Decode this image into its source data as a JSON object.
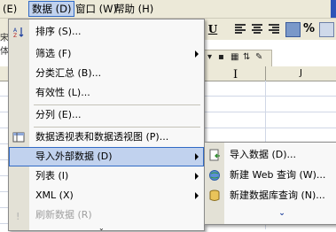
{
  "menubar": {
    "items": [
      {
        "label": "(E)"
      },
      {
        "label": "数据 (D)"
      },
      {
        "label": "窗口 (W)"
      },
      {
        "label": "帮助 (H)"
      }
    ]
  },
  "toolbar": {
    "underline": "U",
    "left_cut": "宋体"
  },
  "sheet": {
    "col_j": "J",
    "col_i_cursor": "I"
  },
  "data_menu": {
    "items": [
      {
        "label": "排序 (S)...",
        "submenu": false,
        "disabled": false
      },
      {
        "label": "筛选 (F)",
        "submenu": true,
        "disabled": false
      },
      {
        "label": "分类汇总 (B)...",
        "submenu": false,
        "disabled": false
      },
      {
        "label": "有效性 (L)...",
        "submenu": false,
        "disabled": false
      },
      {
        "label": "分列 (E)...",
        "submenu": false,
        "disabled": false
      },
      {
        "label": "数据透视表和数据透视图 (P)...",
        "submenu": false,
        "disabled": false
      },
      {
        "label": "导入外部数据 (D)",
        "submenu": true,
        "disabled": false
      },
      {
        "label": "列表 (I)",
        "submenu": true,
        "disabled": false
      },
      {
        "label": "XML (X)",
        "submenu": true,
        "disabled": false
      },
      {
        "label": "刷新数据 (R)",
        "submenu": false,
        "disabled": true
      }
    ]
  },
  "import_submenu": {
    "items": [
      {
        "label": "导入数据 (D)...",
        "icon": "import-data-icon"
      },
      {
        "label": "新建 Web 查询 (W)...",
        "icon": "web-query-icon"
      },
      {
        "label": "新建数据库查询 (N)...",
        "icon": "database-query-icon"
      }
    ]
  }
}
